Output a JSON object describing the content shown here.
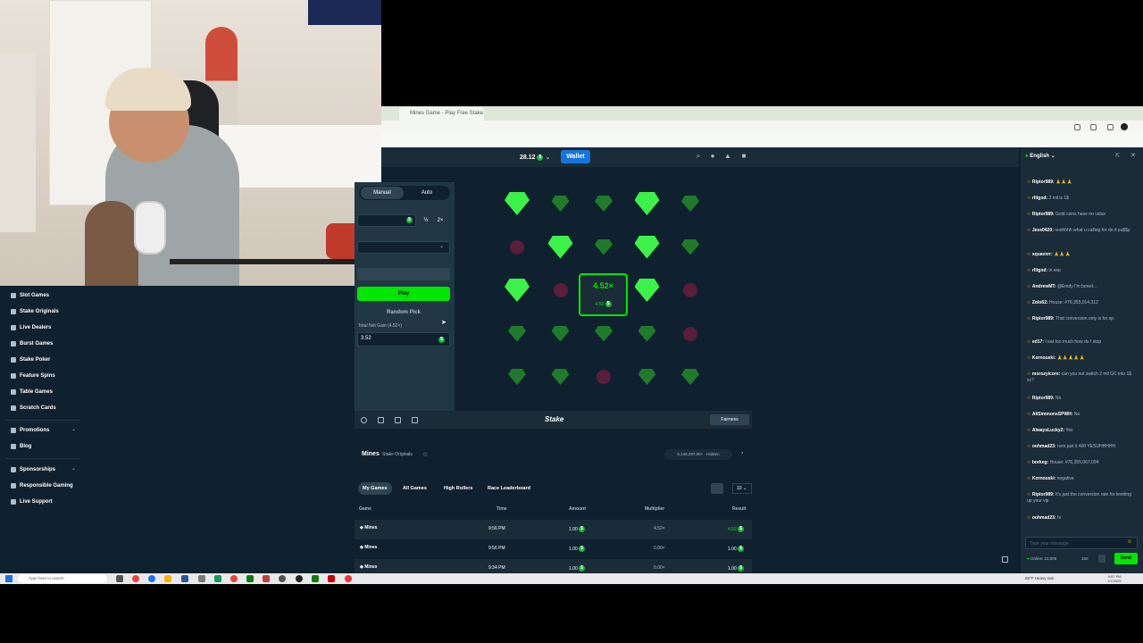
{
  "browser": {
    "tab_title": "Mines Game - Play Free Stake"
  },
  "header": {
    "balance": "28.12",
    "wallet_label": "Wallet"
  },
  "sidebar": {
    "items": [
      {
        "label": "Slot Games"
      },
      {
        "label": "Stake Originals"
      },
      {
        "label": "Live Dealers"
      },
      {
        "label": "Burst Games"
      },
      {
        "label": "Stake Poker"
      },
      {
        "label": "Feature Spins"
      },
      {
        "label": "Table Games"
      },
      {
        "label": "Scratch Cards"
      }
    ],
    "secondary": [
      {
        "label": "Promotions"
      },
      {
        "label": "Blog"
      }
    ],
    "tertiary": [
      {
        "label": "Sponsorships"
      },
      {
        "label": "Responsible Gaming"
      },
      {
        "label": "Live Support"
      }
    ]
  },
  "controls": {
    "tab_manual": "Manual",
    "tab_auto": "Auto",
    "half_label": "½",
    "double_label": "2×",
    "play_label": "Play",
    "random_pick": "Random Pick",
    "profit_label": "Total Net Gain (4.52×)",
    "profit_value": "3.52"
  },
  "board": {
    "cells": [
      "gem-big",
      "gem-dim",
      "gem-dim",
      "gem-big",
      "gem-dim",
      "mine-dim",
      "gem-big",
      "gem-dim",
      "gem-big",
      "gem-dim",
      "gem-big",
      "mine-dim",
      "cashout",
      "gem-big",
      "mine-dim",
      "gem-dim",
      "gem-dim",
      "gem-dim",
      "gem-dim",
      "mine-dim",
      "gem-dim",
      "gem-dim",
      "mine-dim",
      "gem-dim",
      "gem-dim"
    ],
    "cashout_multiplier": "4.52×",
    "cashout_amount": "4.52"
  },
  "footer": {
    "logo": "Stake",
    "fairness": "Fairness"
  },
  "game_info": {
    "name": "Mines",
    "category": "Stake Originals",
    "jackpot": "5,148,297.00+ · Hidden"
  },
  "bets": {
    "tabs": [
      "My Games",
      "All Games",
      "High Rollers",
      "Race Leaderboard"
    ],
    "rows_select": "10",
    "columns": [
      "Game",
      "Time",
      "Amount",
      "Multiplier",
      "Result"
    ],
    "rows": [
      {
        "game": "Mines",
        "time": "9:56 PM",
        "amount": "1.00",
        "multiplier": "4.52×",
        "result": "4.52"
      },
      {
        "game": "Mines",
        "time": "9:56 PM",
        "amount": "1.00",
        "multiplier": "0.00×",
        "result": "1.00"
      },
      {
        "game": "Mines",
        "time": "9:34 PM",
        "amount": "1.00",
        "multiplier": "0.00×",
        "result": "1.00"
      }
    ]
  },
  "chat": {
    "language": "English",
    "messages": [
      {
        "user": "Riptor989:",
        "text": "🙏🙏🙏"
      },
      {
        "user": "rlltgod:",
        "text": "2 mil is 1$"
      },
      {
        "user": "Riptor989:",
        "text": "Gold coins have no value"
      },
      {
        "user": "Jess0420:",
        "text": "ooohhhh what u calling for do it pu$$y"
      },
      {
        "user": "squaverr:",
        "text": "🙏🙏🙏"
      },
      {
        "user": "rlltgod:",
        "text": "in exp"
      },
      {
        "user": "AndrewMT:",
        "text": "@Emdy I'm bored..."
      },
      {
        "user": "Zolo62:",
        "text": "House: #76,355,014,312"
      },
      {
        "user": "Riptor989:",
        "text": "That conversion only is for xp."
      },
      {
        "user": "ed17:",
        "text": "I eat too much how do I stop"
      },
      {
        "user": "Kornouski:",
        "text": "🙏🙏🙏🙏🙏"
      },
      {
        "user": "morozyicore:",
        "text": "can you not switch 2 mil GC into 1$ sc?"
      },
      {
        "user": "Riptor989:",
        "text": "No"
      },
      {
        "user": "AliSimmonsSPWH:",
        "text": "No"
      },
      {
        "user": "AlwaysLucky2:",
        "text": "Yes"
      },
      {
        "user": "oohmad23:",
        "text": "nvm just it 400 YESUHHHHH"
      },
      {
        "user": "borkeg:",
        "text": "House: #76,355,067,094"
      },
      {
        "user": "Kornouski:",
        "text": "negative"
      },
      {
        "user": "Riptor989:",
        "text": "It's just the conversion rate for leveling up your vip"
      },
      {
        "user": "oohmad23:",
        "text": "hi"
      }
    ],
    "input_placeholder": "Type your message",
    "online": "Online: 10,806",
    "char_count": "160",
    "send_label": "Send"
  },
  "taskbar": {
    "search_placeholder": "Type here to search",
    "tray": "59°F Heavy rain",
    "time": "9:57 PM",
    "date": "1/7/2025"
  }
}
